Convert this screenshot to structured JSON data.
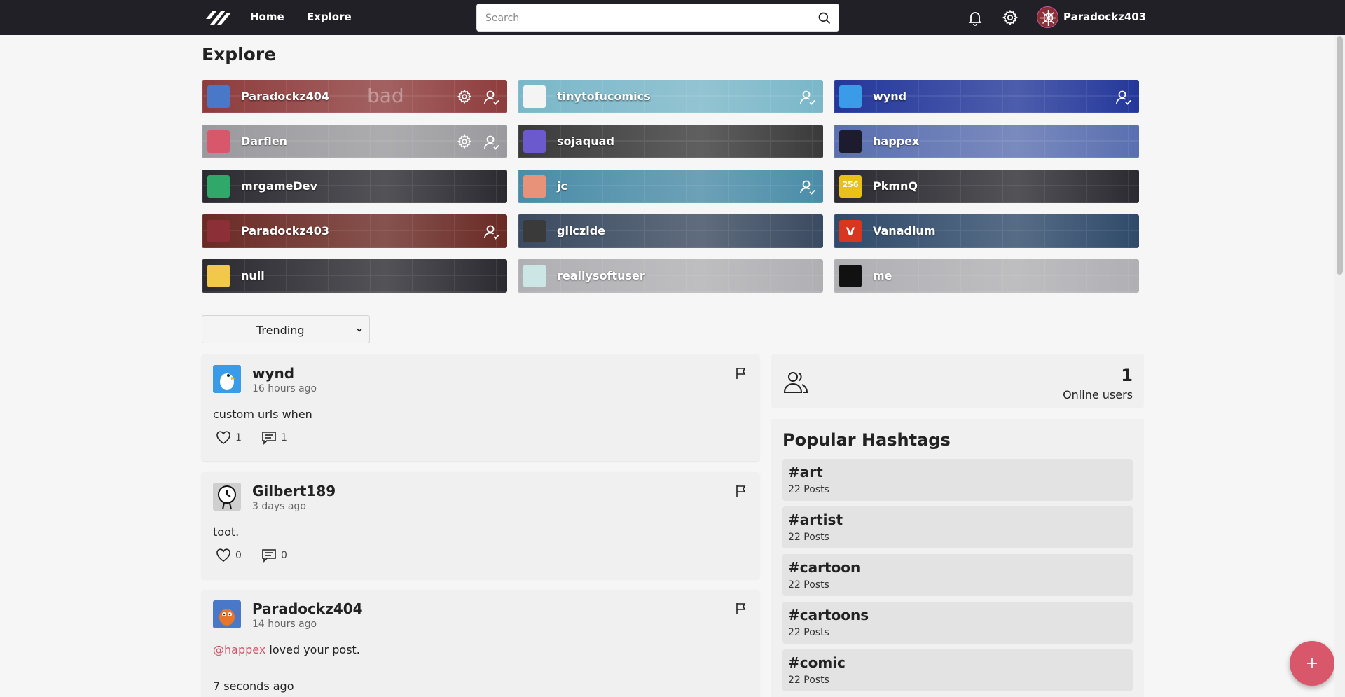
{
  "nav": {
    "home_label": "Home",
    "explore_label": "Explore",
    "search_placeholder": "Search",
    "username": "Paradockz403"
  },
  "page": {
    "title": "Explore"
  },
  "users": [
    {
      "name": "Paradockz404",
      "bg": "#8e3c3c",
      "avatar_color": "#4a78c8",
      "overlay": "bad",
      "settings": true,
      "follow": true
    },
    {
      "name": "tinytofucomics",
      "bg": "#7ab7c9",
      "avatar_color": "#f4f4f4",
      "settings": false,
      "follow": true
    },
    {
      "name": "wynd",
      "bg": "#23379a",
      "avatar_color": "#3a9be8",
      "settings": false,
      "follow": true
    },
    {
      "name": "Darflen",
      "bg": "#9a9a9e",
      "avatar_color": "#d9576a",
      "settings": true,
      "follow": true
    },
    {
      "name": "sojaquad",
      "bg": "#3a3a3a",
      "avatar_color": "#6a5acd",
      "settings": false,
      "follow": false
    },
    {
      "name": "happex",
      "bg": "#5a6fb0",
      "avatar_color": "#1c1c2e",
      "settings": false,
      "follow": false
    },
    {
      "name": "mrgameDev",
      "bg": "#2a2a30",
      "avatar_color": "#2fa86a",
      "settings": false,
      "follow": false
    },
    {
      "name": "jc",
      "bg": "#4a8ca8",
      "avatar_color": "#e8927a",
      "settings": false,
      "follow": true
    },
    {
      "name": "PkmnQ",
      "bg": "#2a2a30",
      "avatar_color": "#e8c219",
      "avatar_text": "256",
      "settings": false,
      "follow": false
    },
    {
      "name": "Paradockz403",
      "bg": "#6a2a24",
      "avatar_color": "#8c2f36",
      "settings": false,
      "follow": true
    },
    {
      "name": "gliczide",
      "bg": "#3a4a60",
      "avatar_color": "#3a3a3a",
      "settings": false,
      "follow": false
    },
    {
      "name": "Vanadium",
      "bg": "#2f4a6a",
      "avatar_color": "#d8361e",
      "avatar_text": "V",
      "settings": false,
      "follow": false
    },
    {
      "name": "null",
      "bg": "#2a2a30",
      "avatar_color": "#f2c84b",
      "settings": false,
      "follow": false
    },
    {
      "name": "reallysoftuser",
      "bg": "#b0b0b4",
      "avatar_color": "#cce6e6",
      "settings": false,
      "follow": false
    },
    {
      "name": "me",
      "bg": "#b0b0b4",
      "avatar_color": "#111111",
      "settings": false,
      "follow": false
    }
  ],
  "sort": {
    "selected": "Trending"
  },
  "posts": [
    {
      "author": "wynd",
      "time": "16 hours ago",
      "body": "custom urls when",
      "likes": "1",
      "comments": "1",
      "avatar_color": "#3a9be8"
    },
    {
      "author": "Gilbert189",
      "time": "3 days ago",
      "body": "toot.",
      "likes": "0",
      "comments": "0",
      "avatar_color": "#cfcfcf"
    },
    {
      "author": "Paradockz404",
      "time": "14 hours ago",
      "mention": "@happex",
      "body": "loved your post.",
      "sub_time": "7 seconds ago",
      "avatar_color": "#4a78c8"
    }
  ],
  "online": {
    "count": "1",
    "label": "Online users"
  },
  "hashtags": {
    "title": "Popular Hashtags",
    "items": [
      {
        "tag": "#art",
        "count": "22 Posts"
      },
      {
        "tag": "#artist",
        "count": "22 Posts"
      },
      {
        "tag": "#cartoon",
        "count": "22 Posts"
      },
      {
        "tag": "#cartoons",
        "count": "22 Posts"
      },
      {
        "tag": "#comic",
        "count": "22 Posts"
      }
    ]
  },
  "colors": {
    "topbar": "#202026",
    "accent": "#d9576a",
    "background": "#f6f6f6"
  },
  "icons": [
    "logo-icon",
    "search-icon",
    "bell-icon",
    "gear-icon",
    "follow-icon",
    "flag-icon",
    "heart-icon",
    "comment-icon",
    "users-icon",
    "plus-icon",
    "chevron-down-icon"
  ]
}
